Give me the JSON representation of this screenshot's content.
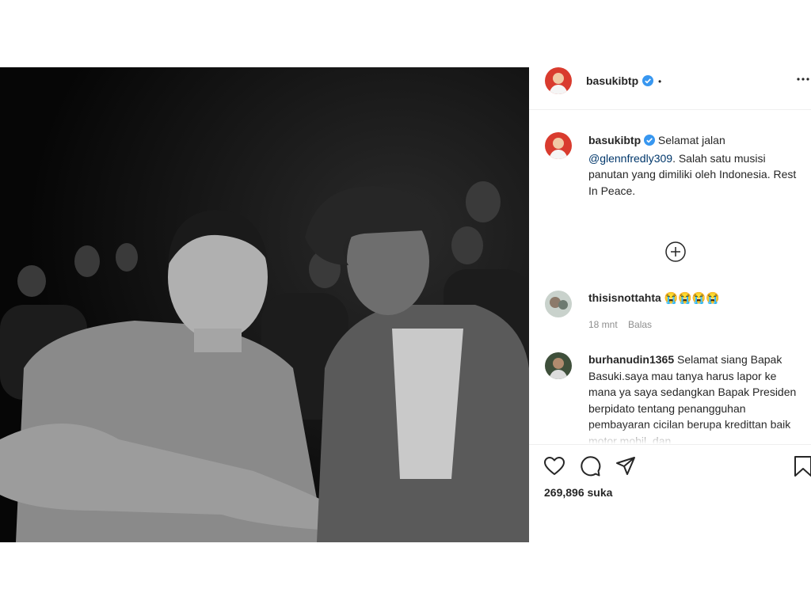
{
  "post": {
    "author": "basukibtp",
    "header_dot": "•",
    "more_icon": "more-horizontal-icon",
    "caption": {
      "username": "basukibtp",
      "text_start": "Selamat jalan",
      "mention": "@glennfredly309",
      "text_end": ". Salah satu musisi panutan yang dimiliki oleh Indonesia. Rest In Peace."
    },
    "load_more_icon": "plus-circle-icon",
    "comments": [
      {
        "username": "thisisnottahta",
        "text": "😭😭😭😭",
        "time": "18 mnt",
        "reply_label": "Balas"
      },
      {
        "username": "burhanudin1365",
        "text": "Selamat siang Bapak Basuki.saya mau tanya harus lapor ke mana ya saya sedangkan Bapak Presiden berpidato tentang penangguhan pembayaran cicilan berupa kredittan baik motor mobil, dan"
      }
    ],
    "likes": "269,896 suka",
    "colors": {
      "link": "#00376b",
      "verified": "#3897f0",
      "muted": "#8e8e8e"
    }
  }
}
